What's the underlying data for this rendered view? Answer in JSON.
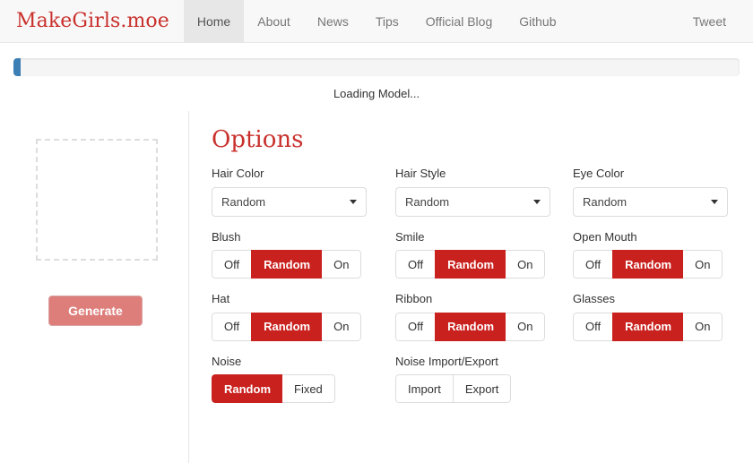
{
  "navbar": {
    "brand": "MakeGirls.moe",
    "links": [
      {
        "label": "Home",
        "active": true
      },
      {
        "label": "About",
        "active": false
      },
      {
        "label": "News",
        "active": false
      },
      {
        "label": "Tips",
        "active": false
      },
      {
        "label": "Official Blog",
        "active": false
      },
      {
        "label": "Github",
        "active": false
      }
    ],
    "tweet_label": "Tweet"
  },
  "progress": {
    "percent": 1,
    "status_text": "Loading Model...",
    "fill_color": "#3c7fb5",
    "track_color": "#f5f5f5"
  },
  "left_panel": {
    "preview_placeholder": "",
    "generate_label": "Generate",
    "generate_color": "#dd7e7b"
  },
  "options": {
    "title": "Options",
    "accent_color": "#c9302c",
    "active_button_color": "#c9211e",
    "fields": [
      {
        "name": "hair-color",
        "label": "Hair Color",
        "type": "select",
        "value": "Random"
      },
      {
        "name": "hair-style",
        "label": "Hair Style",
        "type": "select",
        "value": "Random"
      },
      {
        "name": "eye-color",
        "label": "Eye Color",
        "type": "select",
        "value": "Random"
      },
      {
        "name": "blush",
        "label": "Blush",
        "type": "buttongroup",
        "options": [
          "Off",
          "Random",
          "On"
        ],
        "selected": "Random"
      },
      {
        "name": "smile",
        "label": "Smile",
        "type": "buttongroup",
        "options": [
          "Off",
          "Random",
          "On"
        ],
        "selected": "Random"
      },
      {
        "name": "open-mouth",
        "label": "Open Mouth",
        "type": "buttongroup",
        "options": [
          "Off",
          "Random",
          "On"
        ],
        "selected": "Random"
      },
      {
        "name": "hat",
        "label": "Hat",
        "type": "buttongroup",
        "options": [
          "Off",
          "Random",
          "On"
        ],
        "selected": "Random"
      },
      {
        "name": "ribbon",
        "label": "Ribbon",
        "type": "buttongroup",
        "options": [
          "Off",
          "Random",
          "On"
        ],
        "selected": "Random"
      },
      {
        "name": "glasses",
        "label": "Glasses",
        "type": "buttongroup",
        "options": [
          "Off",
          "Random",
          "On"
        ],
        "selected": "Random"
      },
      {
        "name": "noise",
        "label": "Noise",
        "type": "buttongroup",
        "options": [
          "Random",
          "Fixed"
        ],
        "selected": "Random"
      },
      {
        "name": "noise-import-export",
        "label": "Noise Import/Export",
        "type": "buttongroup",
        "options": [
          "Import",
          "Export"
        ],
        "selected": null
      },
      {
        "name": "spacer",
        "label": "",
        "type": "empty"
      }
    ]
  }
}
